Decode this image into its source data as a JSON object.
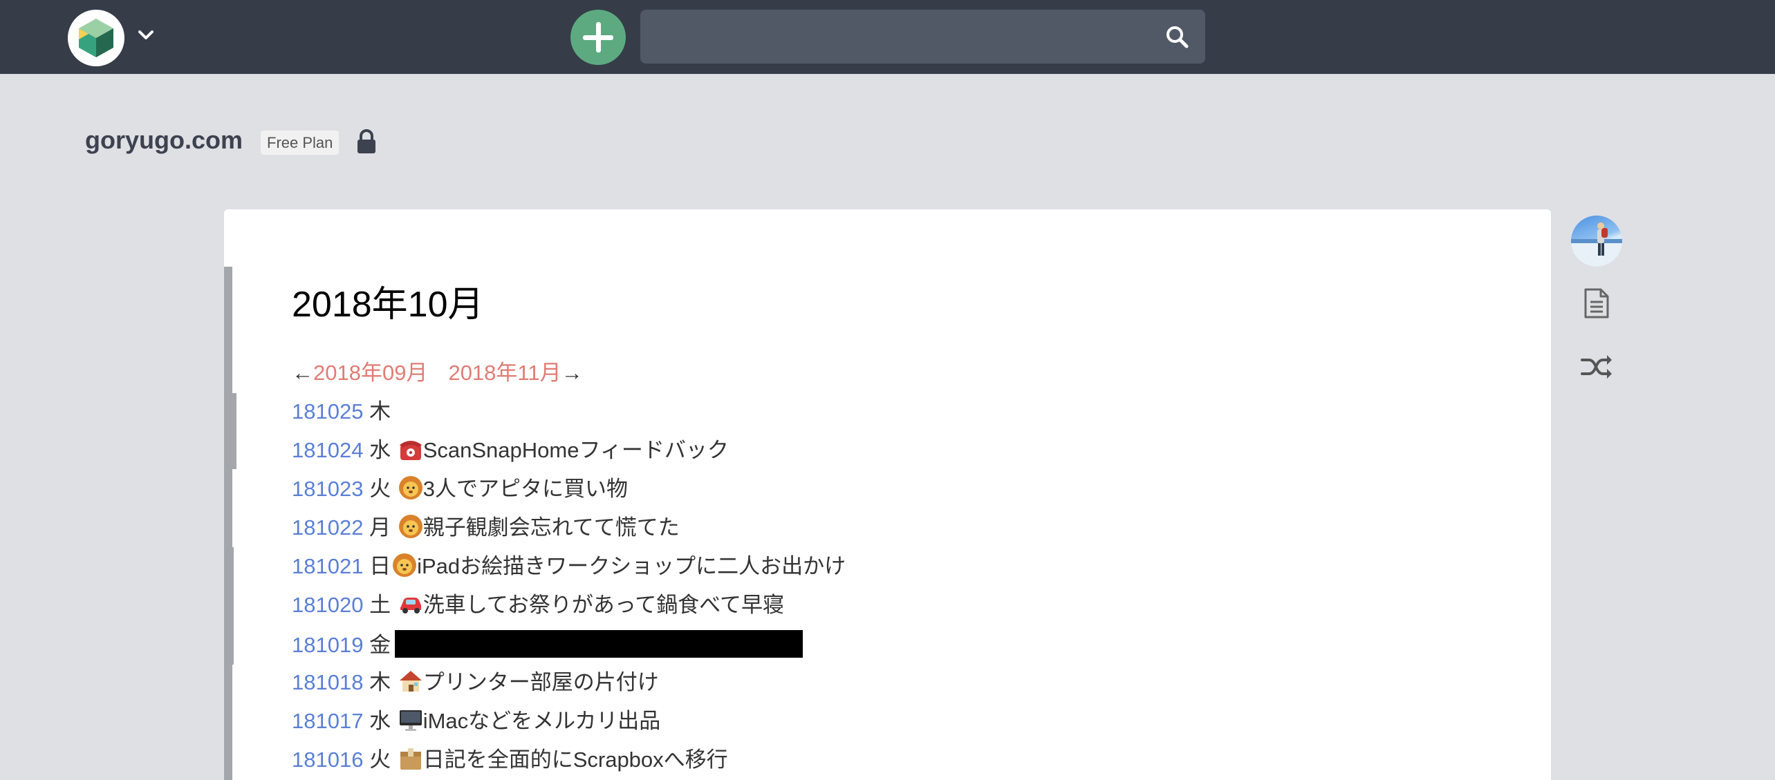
{
  "navbar": {
    "logo_icon": "scrapbox-logo-icon",
    "caret_icon": "chevron-down-icon",
    "add_icon": "plus-icon",
    "search": {
      "value": "",
      "placeholder": ""
    },
    "search_icon": "search-icon"
  },
  "project": {
    "title": "goryugo.com",
    "plan": "Free Plan",
    "lock_icon": "lock-icon"
  },
  "page": {
    "title": "2018年10月",
    "nav": {
      "prev_arrow": "←",
      "prev_label": "2018年09月",
      "next_label": "2018年11月",
      "next_arrow": "→"
    },
    "entries": [
      {
        "date": "181025",
        "dow": "木",
        "emoji": "",
        "text": ""
      },
      {
        "date": "181024",
        "dow": "水",
        "emoji": "telephone-icon",
        "text": "ScanSnapHomeフィードバック"
      },
      {
        "date": "181023",
        "dow": "火",
        "emoji": "lion-icon",
        "text": "3人でアピタに買い物"
      },
      {
        "date": "181022",
        "dow": "月",
        "emoji": "lion-icon",
        "text": "親子観劇会忘れてて慌てた"
      },
      {
        "date": "181021",
        "dow": "日",
        "emoji": "lion-icon",
        "text": "iPadお絵描きワークショップに二人お出かけ"
      },
      {
        "date": "181020",
        "dow": "土",
        "emoji": "car-icon",
        "text": "洗車してお祭りがあって鍋食べて早寝"
      },
      {
        "date": "181019",
        "dow": "金",
        "emoji": "",
        "text": ""
      },
      {
        "date": "181018",
        "dow": "木",
        "emoji": "house-icon",
        "text": "プリンター部屋の片付け"
      },
      {
        "date": "181017",
        "dow": "水",
        "emoji": "desktop-computer-icon",
        "text": "iMacなどをメルカリ出品"
      },
      {
        "date": "181016",
        "dow": "火",
        "emoji": "box-icon",
        "text": "日記を全面的にScrapboxへ移行"
      }
    ]
  },
  "sidebar": {
    "avatar": "user-avatar",
    "doc_icon": "document-icon",
    "shuffle_icon": "shuffle-icon"
  },
  "colors": {
    "navbar": "#363c48",
    "background": "#dfe0e4",
    "add_button": "#5daa81",
    "date_link": "#5b7fd6",
    "month_link": "#e07c74"
  }
}
